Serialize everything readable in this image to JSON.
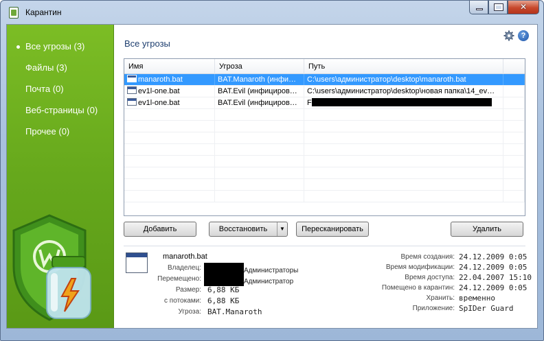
{
  "window": {
    "title": "Карантин"
  },
  "sidebar": {
    "items": [
      {
        "label": "Все угрозы (3)",
        "active": true
      },
      {
        "label": "Файлы (3)",
        "active": false
      },
      {
        "label": "Почта (0)",
        "active": false
      },
      {
        "label": "Веб-страницы (0)",
        "active": false
      },
      {
        "label": "Прочее (0)",
        "active": false
      }
    ]
  },
  "main": {
    "heading": "Все угрозы",
    "help_label": "?"
  },
  "table": {
    "columns": [
      "Имя",
      "Угроза",
      "Путь",
      ""
    ],
    "rows": [
      {
        "name": "manaroth.bat",
        "threat": "BAT.Manaroth (инфи…",
        "path": "C:\\users\\администратор\\desktop\\manaroth.bat",
        "selected": true
      },
      {
        "name": "ev1l-one.bat",
        "threat": "BAT.Evil (инфициров…",
        "path": "C:\\users\\администратор\\desktop\\новая папка\\14_ev…",
        "selected": false
      },
      {
        "name": "ev1l-one.bat",
        "threat": "BAT.Evil (инфициров…",
        "path": "F",
        "selected": false
      }
    ]
  },
  "buttons": {
    "add": "Добавить",
    "restore": "Восстановить",
    "restore_arrow": "▼",
    "rescan": "Пересканировать",
    "delete": "Удалить"
  },
  "details": {
    "file_name": "manaroth.bat",
    "left": [
      {
        "label": "Владелец:",
        "value": "Администраторы"
      },
      {
        "label": "Перемещено:",
        "value": "Администратор"
      },
      {
        "label": "Размер:",
        "value": "6,88 КБ"
      },
      {
        "label": "с потоками:",
        "value": "6,88 КБ"
      },
      {
        "label": "Угроза:",
        "value": "BAT.Manaroth"
      }
    ],
    "right": [
      {
        "label": "Время создания:",
        "value": "24.12.2009 0:05"
      },
      {
        "label": "Время модификации:",
        "value": "24.12.2009 0:05"
      },
      {
        "label": "Время доступа:",
        "value": "22.04.2007 15:10"
      },
      {
        "label": "Помещено в карантин:",
        "value": "24.12.2009 0:05"
      },
      {
        "label": "Хранить:",
        "value": "временно"
      },
      {
        "label": "Приложение:",
        "value": "SpIDer Guard"
      }
    ]
  },
  "colors": {
    "sidebar_green": "#6aac1e",
    "selection_blue": "#3399ff",
    "heading_blue": "#1c3d6e"
  },
  "icons": [
    "app-icon",
    "minimize-icon",
    "maximize-icon",
    "close-icon",
    "gear-icon",
    "help-icon",
    "file-icon",
    "shield-logo",
    "jar-icon"
  ]
}
